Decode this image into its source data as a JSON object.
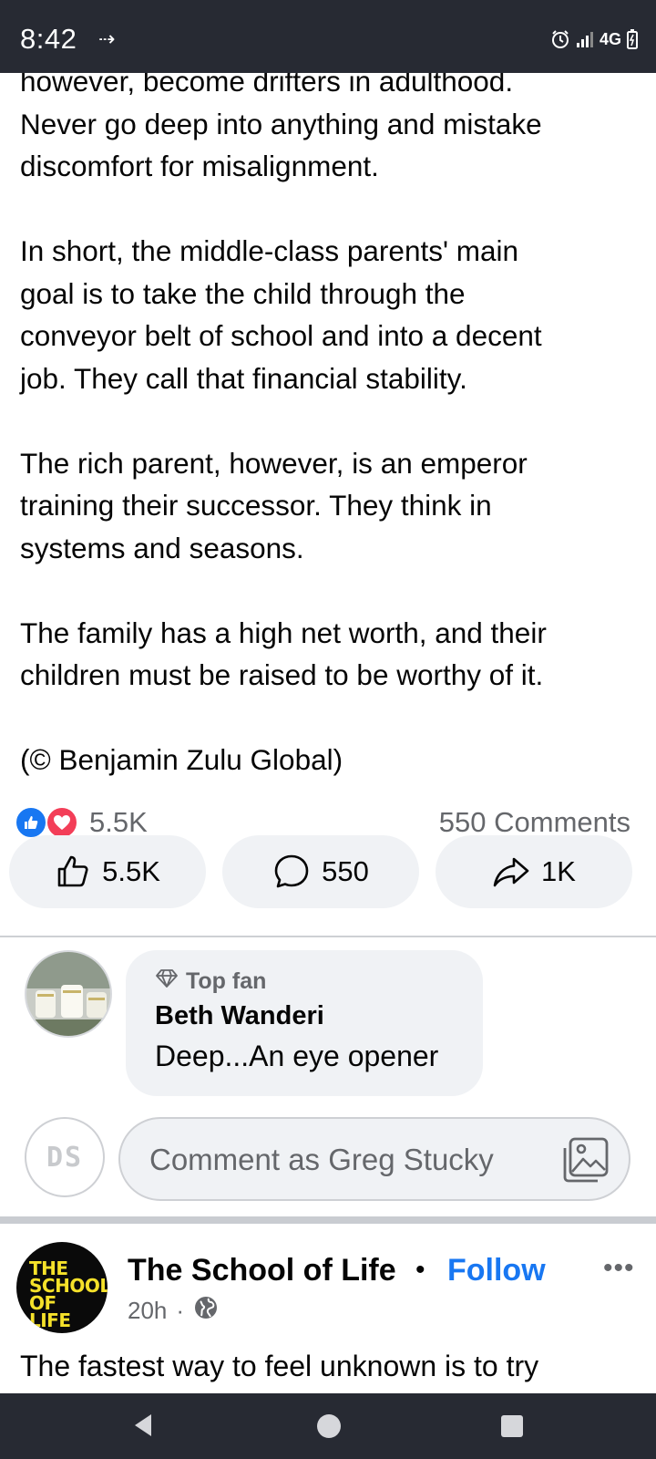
{
  "status_bar": {
    "time": "8:42",
    "network": "4G",
    "icons": [
      "missed-call-icon",
      "alarm-icon",
      "signal-icon",
      "battery-icon"
    ]
  },
  "post": {
    "paragraphs": [
      "however, become drifters in adulthood.\nNever go deep into anything and mistake\ndiscomfort for misalignment.",
      "In short, the middle-class parents' main\ngoal is to take the child through the\nconveyor belt of school and into a decent\njob. They call that financial stability.",
      "The rich parent, however, is an emperor\ntraining their successor. They think in\nsystems and seasons.",
      "The family has a high net worth, and their\nchildren must be raised to be worthy of it.",
      "(© Benjamin Zulu Global)"
    ],
    "reactions_count": "5.5K",
    "comments_count": "550 Comments",
    "actions": {
      "like": "5.5K",
      "comment": "550",
      "share": "1K"
    }
  },
  "comment": {
    "badge": "Top fan",
    "author": "Beth Wanderi",
    "text": "Deep...An eye opener"
  },
  "composer": {
    "avatar_initials": "DS",
    "placeholder": "Comment as Greg Stucky"
  },
  "next_post": {
    "logo_text": "THE SCHOOL OF LIFE",
    "page_name": "The School of Life",
    "separator": "•",
    "follow": "Follow",
    "more": "•••",
    "time": "20h",
    "meta_separator": "·",
    "text": "The fastest way to feel unknown is to try"
  },
  "colors": {
    "accent": "#1877f2",
    "love": "#f33e58",
    "bar": "#272a33",
    "button_bg": "#f0f2f5",
    "muted_text": "#65676b",
    "logo_yellow": "#f5e12a"
  }
}
